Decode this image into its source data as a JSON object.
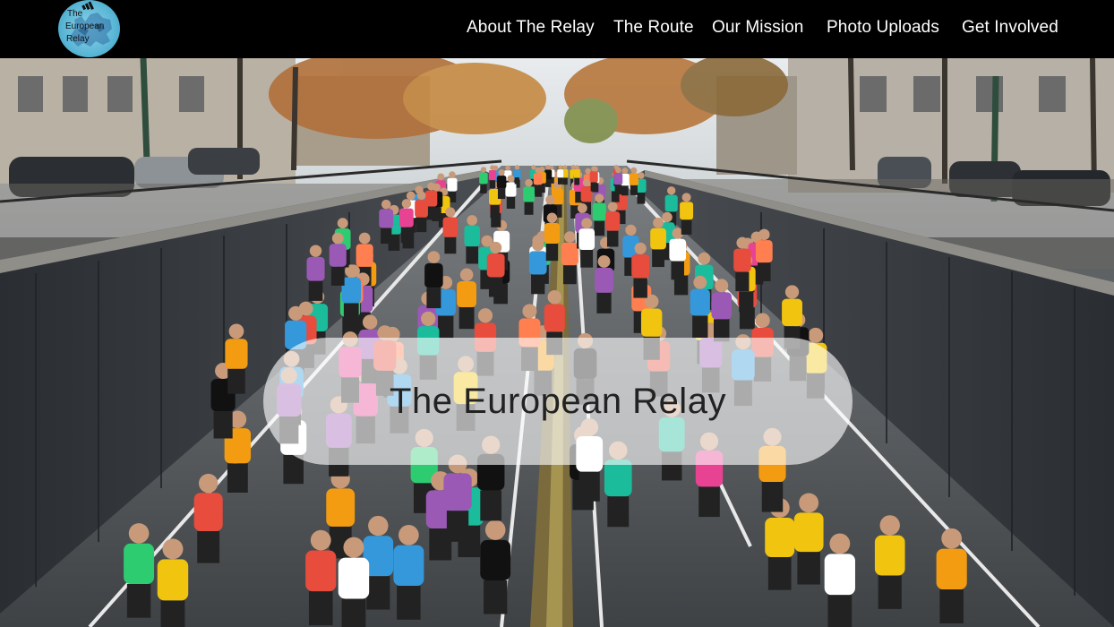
{
  "logo": {
    "lines": [
      "The",
      "European",
      "Relay"
    ],
    "brand_mark": "adidas-logo-icon",
    "colors": {
      "circle": "#5bb7d6",
      "map": "#2f6fa5"
    }
  },
  "nav": {
    "items": [
      {
        "label": "About The Relay"
      },
      {
        "label": "The Route"
      },
      {
        "label": "Our Mission"
      },
      {
        "label": "Photo Uploads"
      },
      {
        "label": "Get Involved"
      }
    ]
  },
  "hero": {
    "image": "marathon-runners-photo",
    "title": "The European Relay"
  },
  "colors": {
    "header_bg": "#000000",
    "nav_text": "#ffffff",
    "title_card": "#ffffff"
  }
}
